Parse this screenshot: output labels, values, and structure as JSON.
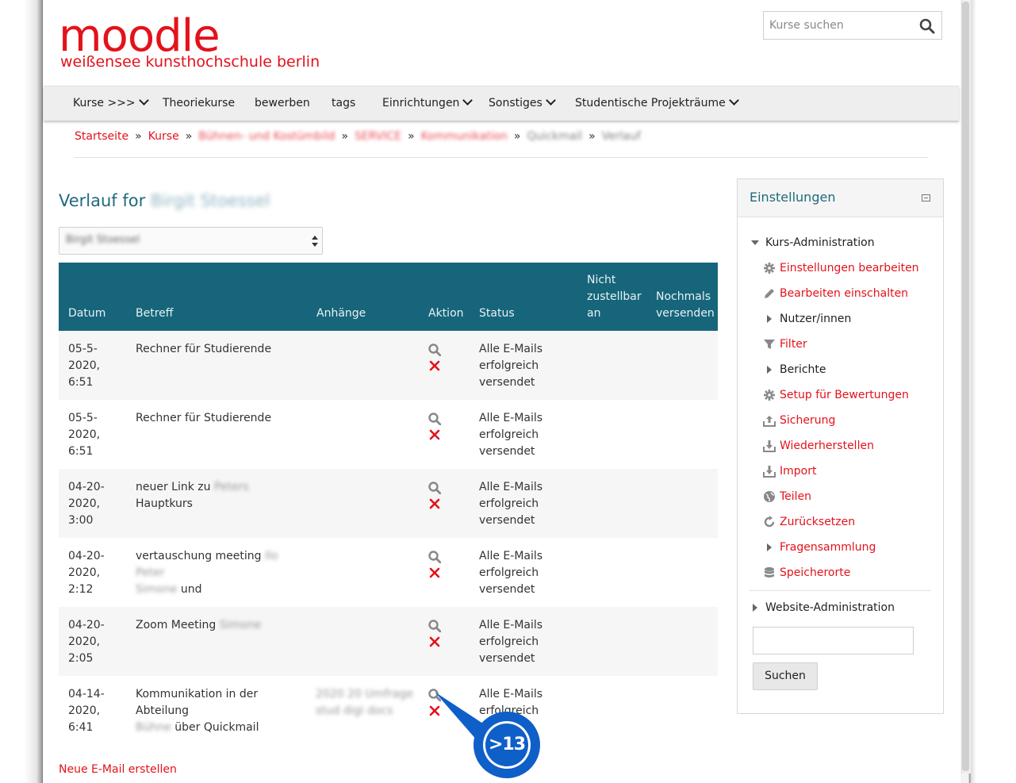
{
  "header": {
    "logo_word": "moodle",
    "logo_sub": "weißensee kunsthochschule berlin",
    "search_placeholder": "Kurse suchen"
  },
  "nav": [
    {
      "label": "Kurse >>>",
      "dropdown": true
    },
    {
      "label": "Theoriekurse",
      "dropdown": false
    },
    {
      "label": "bewerben",
      "dropdown": false
    },
    {
      "label": "tags",
      "dropdown": false
    },
    {
      "label": "Einrichtungen",
      "dropdown": true
    },
    {
      "label": "Sonstiges",
      "dropdown": true
    },
    {
      "label": "Studentische Projekträume",
      "dropdown": true
    }
  ],
  "breadcrumb": {
    "home": "Startseite",
    "courses": "Kurse",
    "redacted_1": "Bühnen- und Kostümbild",
    "redacted_2": "SERVICE",
    "redacted_3": "Kommunikation",
    "redacted_4": "Quickmail",
    "redacted_5": "Verlauf"
  },
  "main": {
    "title_prefix": "Verlauf for",
    "title_name_redacted": "Birgit Stoessel",
    "select_value_redacted": "Birgit Stoessel",
    "new_mail_link": "Neue E-Mail erstellen"
  },
  "table": {
    "headers": {
      "datum": "Datum",
      "betreff": "Betreff",
      "anhaenge": "Anhänge",
      "aktion": "Aktion",
      "status": "Status",
      "nicht1": "Nicht",
      "nicht2": "zustellbar",
      "nicht3": "an",
      "noch1": "Nochmals",
      "noch2": "versenden"
    },
    "rows": [
      {
        "d1": "05-5-",
        "d2": "2020,",
        "d3": "6:51",
        "s1": "Rechner für Studierende",
        "s1b": "",
        "s2": "",
        "s2b": "",
        "att1": "",
        "att2": "",
        "st1": "Alle E-Mails",
        "st2": "erfolgreich",
        "st3": "versendet"
      },
      {
        "d1": "05-5-",
        "d2": "2020,",
        "d3": "6:51",
        "s1": "Rechner für Studierende",
        "s1b": "",
        "s2": "",
        "s2b": "",
        "att1": "",
        "att2": "",
        "st1": "Alle E-Mails",
        "st2": "erfolgreich",
        "st3": "versendet"
      },
      {
        "d1": "04-20-",
        "d2": "2020,",
        "d3": "3:00",
        "s1": "neuer Link zu",
        "s1b": "Peters",
        "s1c": "Hauptkurs",
        "s2": "",
        "s2b": "",
        "att1": "",
        "att2": "",
        "st1": "Alle E-Mails",
        "st2": "erfolgreich",
        "st3": "versendet"
      },
      {
        "d1": "04-20-",
        "d2": "2020,",
        "d3": "2:12",
        "s1": "vertauschung meeting",
        "s1b": "Ilo Peter",
        "s2": "und",
        "s2b": "Simone",
        "att1": "",
        "att2": "",
        "st1": "Alle E-Mails",
        "st2": "erfolgreich",
        "st3": "versendet"
      },
      {
        "d1": "04-20-",
        "d2": "2020,",
        "d3": "2:05",
        "s1": "Zoom Meeting",
        "s1b": "Simone",
        "s2": "",
        "s2b": "",
        "att1": "",
        "att2": "",
        "st1": "Alle E-Mails",
        "st2": "erfolgreich",
        "st3": "versendet"
      },
      {
        "d1": "04-14-",
        "d2": "2020,",
        "d3": "6:41",
        "s1": "Kommunikation in der Abteilung",
        "s1b": "",
        "s2": "über Quickmail",
        "s2b": "Bühne",
        "att1": "2020 20 Umfrage",
        "att2": "stud digi docs",
        "st1": "Alle E-Mails",
        "st2": "erfolgreich",
        "st3": ""
      }
    ]
  },
  "callout": {
    "label": ">13"
  },
  "sidebar": {
    "title": "Einstellungen",
    "kurs_admin": "Kurs-Administration",
    "items": [
      {
        "label": "Einstellungen bearbeiten",
        "icon": "gear-icon",
        "kind": "link"
      },
      {
        "label": "Bearbeiten einschalten",
        "icon": "pencil-icon",
        "kind": "link"
      },
      {
        "label": "Nutzer/innen",
        "icon": "expand-arrow-icon",
        "kind": "plain"
      },
      {
        "label": "Filter",
        "icon": "filter-icon",
        "kind": "link"
      },
      {
        "label": "Berichte",
        "icon": "expand-arrow-icon",
        "kind": "plain"
      },
      {
        "label": "Setup für Bewertungen",
        "icon": "gear-icon",
        "kind": "link"
      },
      {
        "label": "Sicherung",
        "icon": "upload-icon",
        "kind": "link"
      },
      {
        "label": "Wiederherstellen",
        "icon": "download-icon",
        "kind": "link"
      },
      {
        "label": "Import",
        "icon": "download-icon",
        "kind": "link"
      },
      {
        "label": "Teilen",
        "icon": "globe-icon",
        "kind": "link"
      },
      {
        "label": "Zurücksetzen",
        "icon": "refresh-icon",
        "kind": "link"
      },
      {
        "label": "Fragensammlung",
        "icon": "expand-arrow-icon",
        "kind": "link"
      },
      {
        "label": "Speicherorte",
        "icon": "database-icon",
        "kind": "link"
      }
    ],
    "website_admin": "Website-Administration",
    "search_button": "Suchen"
  },
  "colors": {
    "brand_red": "#e3121b",
    "table_header": "#16657a",
    "heading_teal": "#1f6a7e",
    "callout_blue": "#0f5fc8"
  }
}
